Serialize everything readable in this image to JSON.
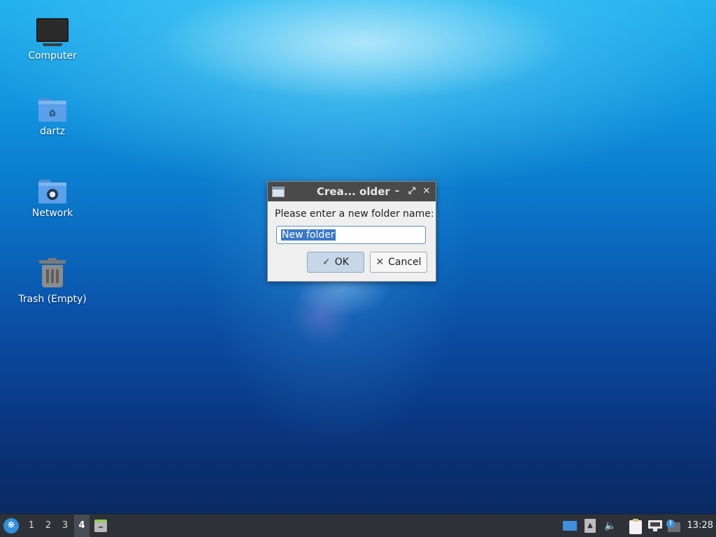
{
  "desktop": {
    "icons": [
      {
        "label": "Computer",
        "icon": "computer-icon"
      },
      {
        "label": "dartz",
        "icon": "home-folder-icon"
      },
      {
        "label": "Network",
        "icon": "network-folder-icon"
      },
      {
        "label": "Trash (Empty)",
        "icon": "trash-icon"
      }
    ]
  },
  "dialog": {
    "title": "Crea... older",
    "minimize_glyph": "–",
    "maximize_glyph": "⤢",
    "close_glyph": "✕",
    "prompt": "Please enter a new folder name:",
    "input_value": "New folder",
    "ok_icon": "✓",
    "ok_label": "OK",
    "cancel_icon": "✕",
    "cancel_label": "Cancel"
  },
  "taskbar": {
    "start_icon": "start-menu-icon",
    "workspaces": [
      "1",
      "2",
      "3",
      "4"
    ],
    "active_workspace": "4",
    "tray_icons": [
      "show-desktop-icon",
      "eject-icon",
      "volume-icon",
      "clipboard-icon",
      "network-icon",
      "update-notifier-icon"
    ],
    "clock": "13:28"
  }
}
